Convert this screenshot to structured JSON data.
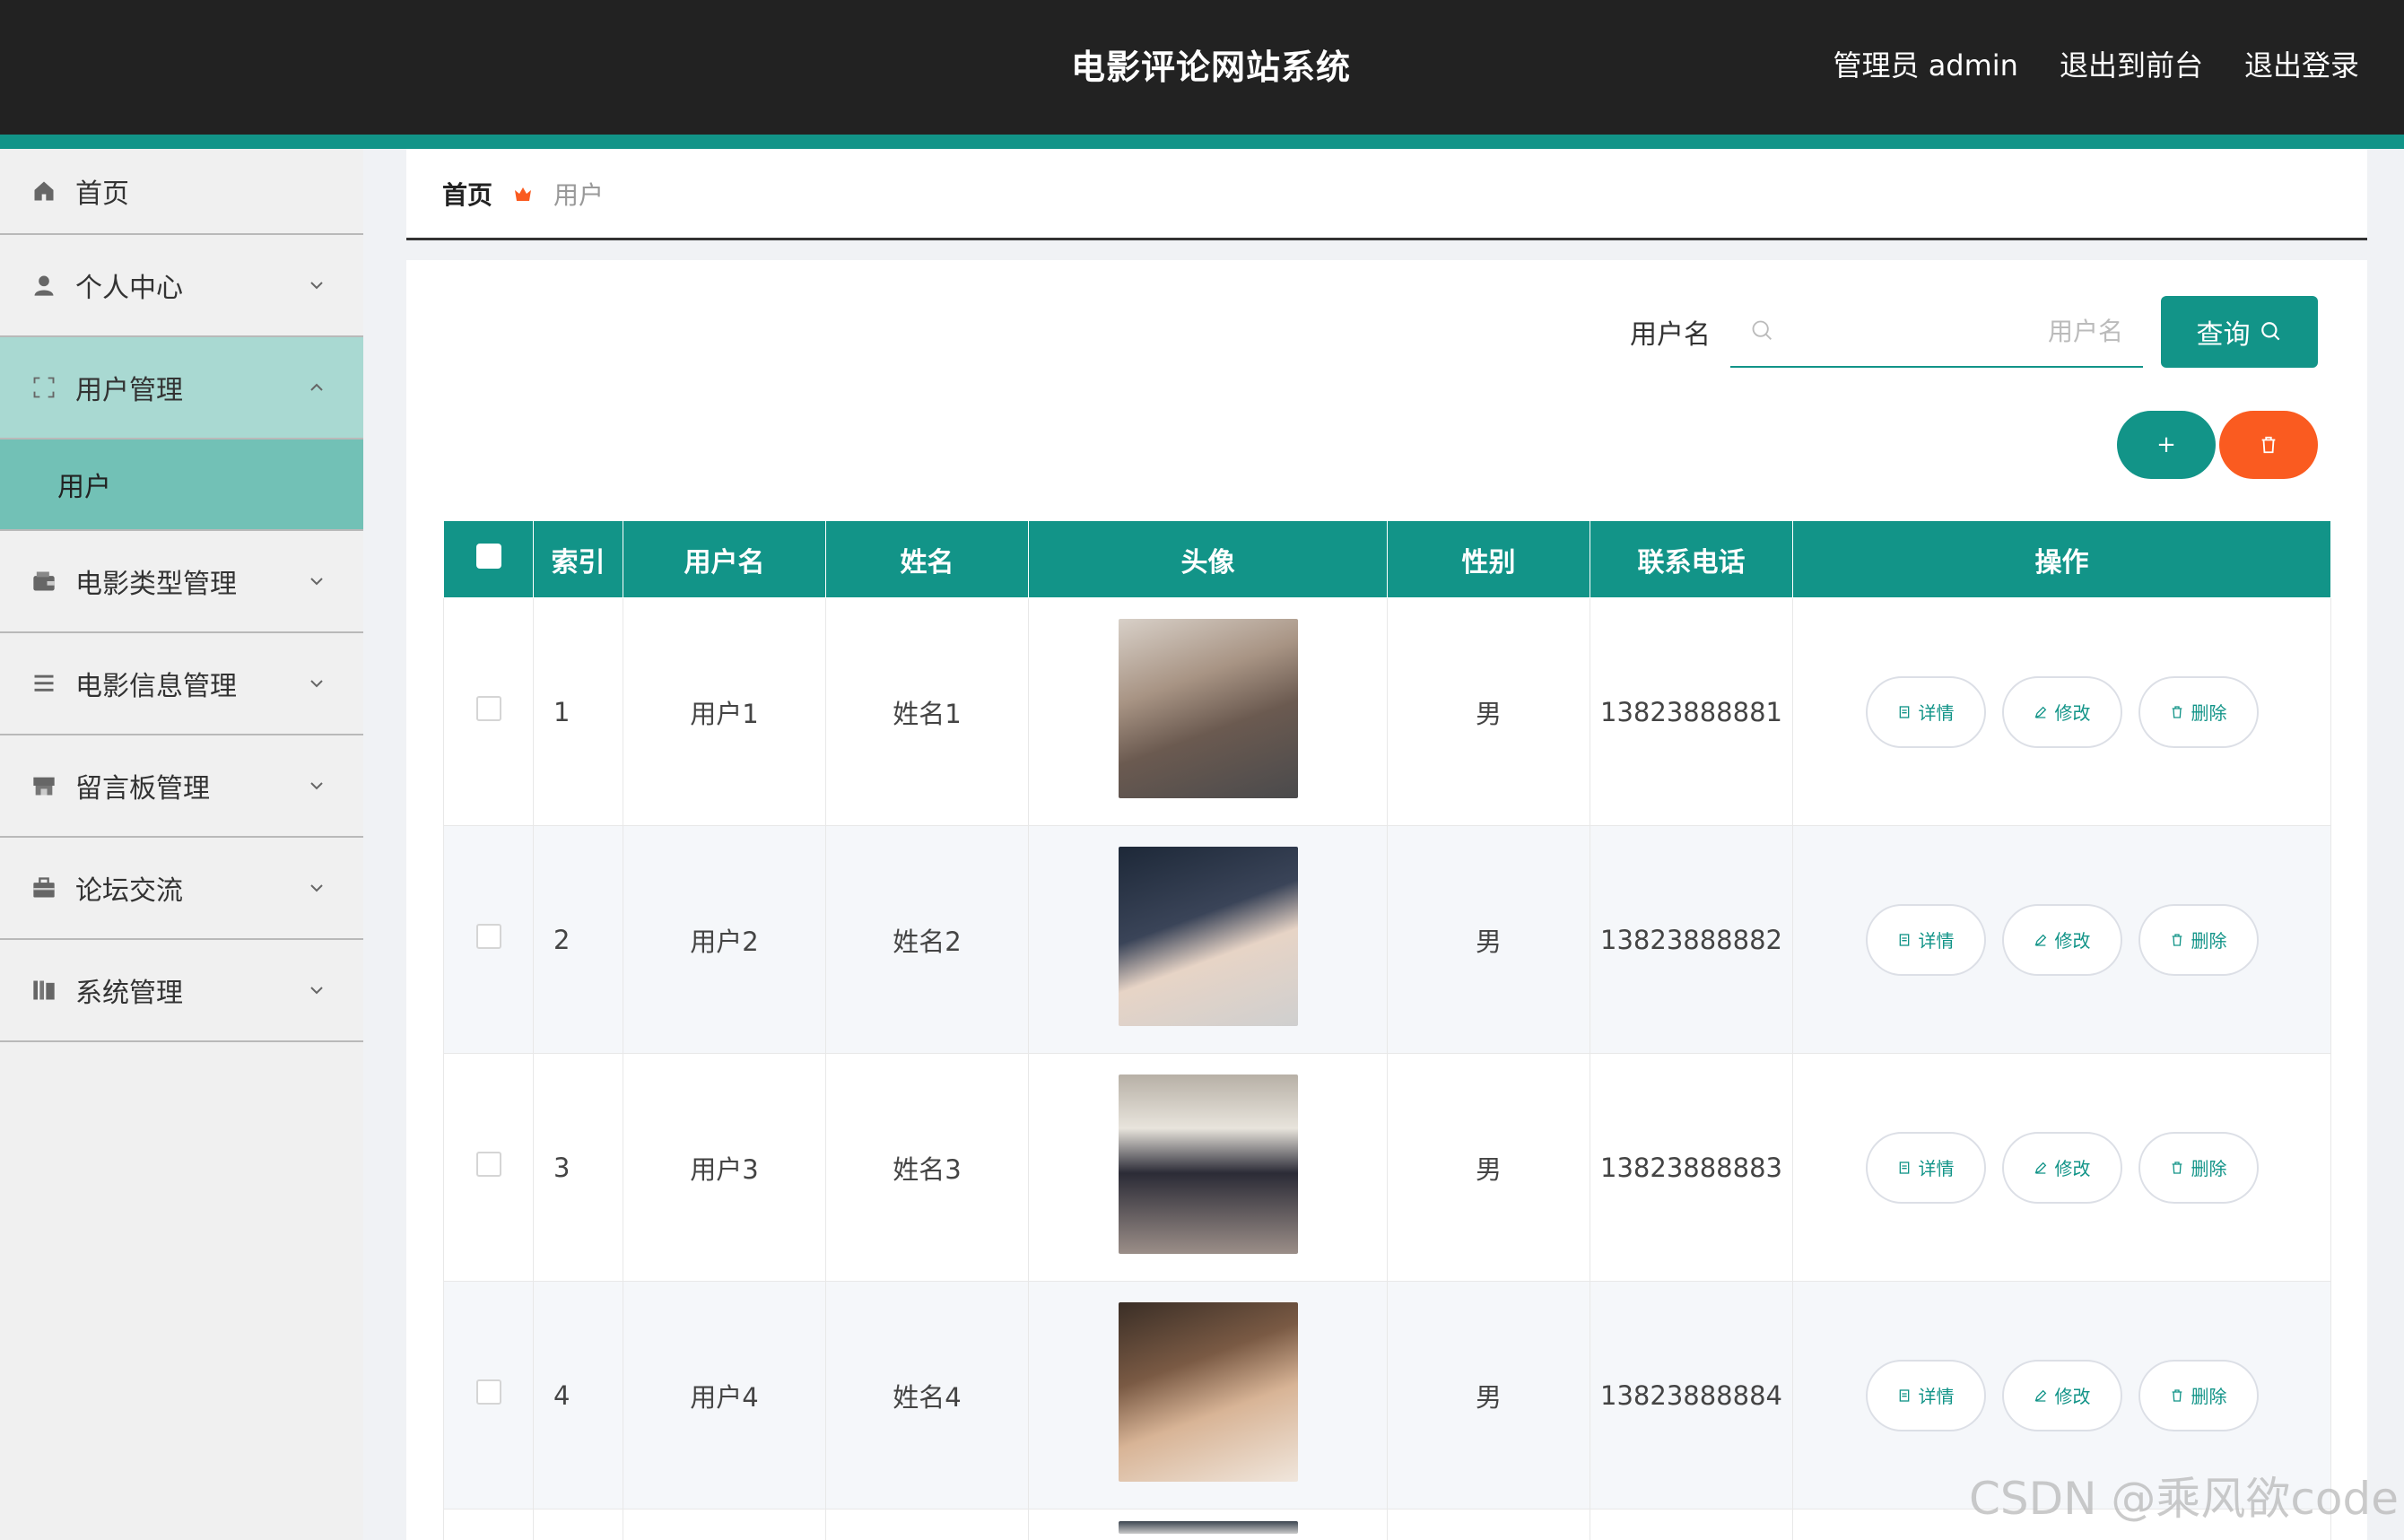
{
  "header": {
    "title": "电影评论网站系统",
    "admin_label": "管理员 admin",
    "to_front_label": "退出到前台",
    "logout_label": "退出登录"
  },
  "sidebar": {
    "items": [
      {
        "label": "首页",
        "icon": "home-icon"
      },
      {
        "label": "个人中心",
        "icon": "person-icon"
      },
      {
        "label": "用户管理",
        "icon": "frame-icon"
      },
      {
        "label": "电影类型管理",
        "icon": "wallet-icon"
      },
      {
        "label": "电影信息管理",
        "icon": "list-icon"
      },
      {
        "label": "留言板管理",
        "icon": "shop-icon"
      },
      {
        "label": "论坛交流",
        "icon": "briefcase-icon"
      },
      {
        "label": "系统管理",
        "icon": "books-icon"
      }
    ],
    "sub_item": "用户"
  },
  "breadcrumb": {
    "home": "首页",
    "current": "用户"
  },
  "search": {
    "label": "用户名",
    "placeholder": "用户名",
    "value": "",
    "button_label": "查询"
  },
  "actions": {
    "add_symbol": "+",
    "delete_icon": "trash-icon"
  },
  "table": {
    "headers": [
      "索引",
      "用户名",
      "姓名",
      "头像",
      "性别",
      "联系电话",
      "操作"
    ],
    "rows": [
      {
        "index": "1",
        "username": "用户1",
        "name": "姓名1",
        "gender": "男",
        "phone": "13823888881"
      },
      {
        "index": "2",
        "username": "用户2",
        "name": "姓名2",
        "gender": "男",
        "phone": "13823888882"
      },
      {
        "index": "3",
        "username": "用户3",
        "name": "姓名3",
        "gender": "男",
        "phone": "13823888883"
      },
      {
        "index": "4",
        "username": "用户4",
        "name": "姓名4",
        "gender": "男",
        "phone": "13823888884"
      }
    ],
    "ops": {
      "detail": "详情",
      "edit": "修改",
      "delete": "删除"
    }
  },
  "watermark": "CSDN @乘风欲code",
  "colors": {
    "primary": "#129488",
    "danger": "#fa5b20",
    "topbar": "#222222",
    "sidebar_active": "#a9d9d2",
    "sidebar_sub": "#72c1b6"
  }
}
